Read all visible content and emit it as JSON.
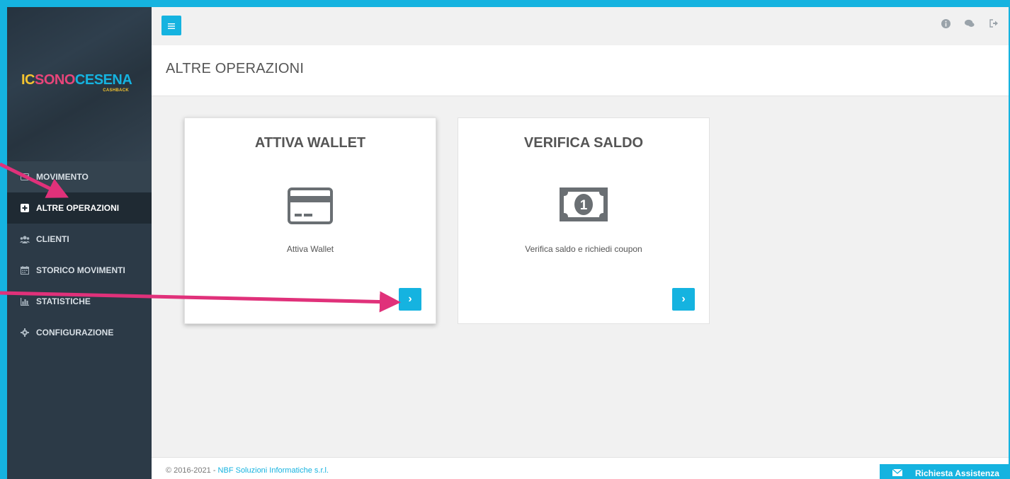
{
  "brand": {
    "logo_parts": [
      "IC",
      "SONO",
      "CESENA"
    ],
    "logo_sub": "CASHBACK",
    "accent": "#15b3e0"
  },
  "sidebar": {
    "items": [
      {
        "label": "MOVIMENTO",
        "icon": "credit-card-icon"
      },
      {
        "label": "ALTRE OPERAZIONI",
        "icon": "plus-square-icon",
        "active": true
      },
      {
        "label": "CLIENTI",
        "icon": "users-icon"
      },
      {
        "label": "STORICO MOVIMENTI",
        "icon": "calendar-icon"
      },
      {
        "label": "STATISTICHE",
        "icon": "bar-chart-icon"
      },
      {
        "label": "CONFIGURAZIONE",
        "icon": "gear-icon"
      }
    ]
  },
  "topbar": {
    "icons": [
      "italian-flag-icon",
      "info-icon",
      "chat-icon",
      "logout-icon"
    ]
  },
  "page": {
    "title": "ALTRE OPERAZIONI"
  },
  "cards": [
    {
      "title": "ATTIVA WALLET",
      "description": "Attiva Wallet",
      "icon": "credit-card-icon",
      "button": "›"
    },
    {
      "title": "VERIFICA SALDO",
      "description": "Verifica saldo e richiedi coupon",
      "icon": "money-bill-icon",
      "button": "›"
    }
  ],
  "footer": {
    "copyright": "© 2016-2021 - ",
    "company": "NBF Soluzioni Informatiche s.r.l.",
    "support_label": "Richiesta Assistenza"
  }
}
